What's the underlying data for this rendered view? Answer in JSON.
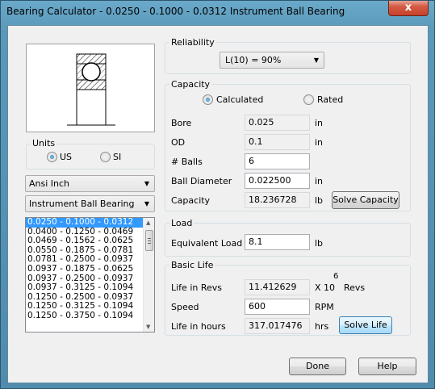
{
  "window": {
    "title": "Bearing Calculator - 0.0250 - 0.1000 - 0.0312 Instrument Ball Bearing",
    "close_label": "x"
  },
  "units": {
    "label": "Units",
    "options": [
      "US",
      "SI"
    ],
    "selected": "US"
  },
  "standard_combo": {
    "value": "Ansi Inch"
  },
  "type_combo": {
    "value": "Instrument Ball Bearing"
  },
  "size_list": {
    "items": [
      "0.0250 - 0.1000 - 0.0312",
      "0.0400 - 0.1250 - 0.0469",
      "0.0469 - 0.1562 - 0.0625",
      "0.0550 - 0.1875 - 0.0781",
      "0.0781 - 0.2500 - 0.0937",
      "0.0937 - 0.1875 - 0.0625",
      "0.0937 - 0.2500 - 0.0937",
      "0.0937 - 0.3125 - 0.1094",
      "0.1250 - 0.2500 - 0.0937",
      "0.1250 - 0.3125 - 0.1094",
      "0.1250 - 0.3750 - 0.1094"
    ],
    "selected_index": 0
  },
  "reliability": {
    "label": "Reliability",
    "value": "L(10) = 90%"
  },
  "capacity": {
    "label": "Capacity",
    "mode_calculated": "Calculated",
    "mode_rated": "Rated",
    "selected_mode": "Calculated",
    "bore": {
      "label": "Bore",
      "value": "0.025",
      "unit": "in"
    },
    "od": {
      "label": "OD",
      "value": "0.1",
      "unit": "in"
    },
    "balls": {
      "label": "# Balls",
      "value": "6"
    },
    "ball_diameter": {
      "label": "Ball Diameter",
      "value": "0.022500",
      "unit": "in"
    },
    "capacity": {
      "label": "Capacity",
      "value": "18.236728",
      "unit": "lb"
    },
    "solve_label": "Solve Capacity"
  },
  "load": {
    "label": "Load",
    "equivalent": {
      "label": "Equivalent Load",
      "value": "8.1",
      "unit": "lb"
    }
  },
  "basic_life": {
    "label": "Basic Life",
    "revs": {
      "label": "Life in Revs",
      "value": "11.412629",
      "unit": "X 10",
      "exponent": "6",
      "unit_suffix": "Revs"
    },
    "speed": {
      "label": "Speed",
      "value": "600",
      "unit": "RPM"
    },
    "hours": {
      "label": "Life in hours",
      "value": "317.017476",
      "unit": "hrs"
    },
    "solve_label": "Solve Life"
  },
  "footer": {
    "done_label": "Done",
    "help_label": "Help"
  }
}
